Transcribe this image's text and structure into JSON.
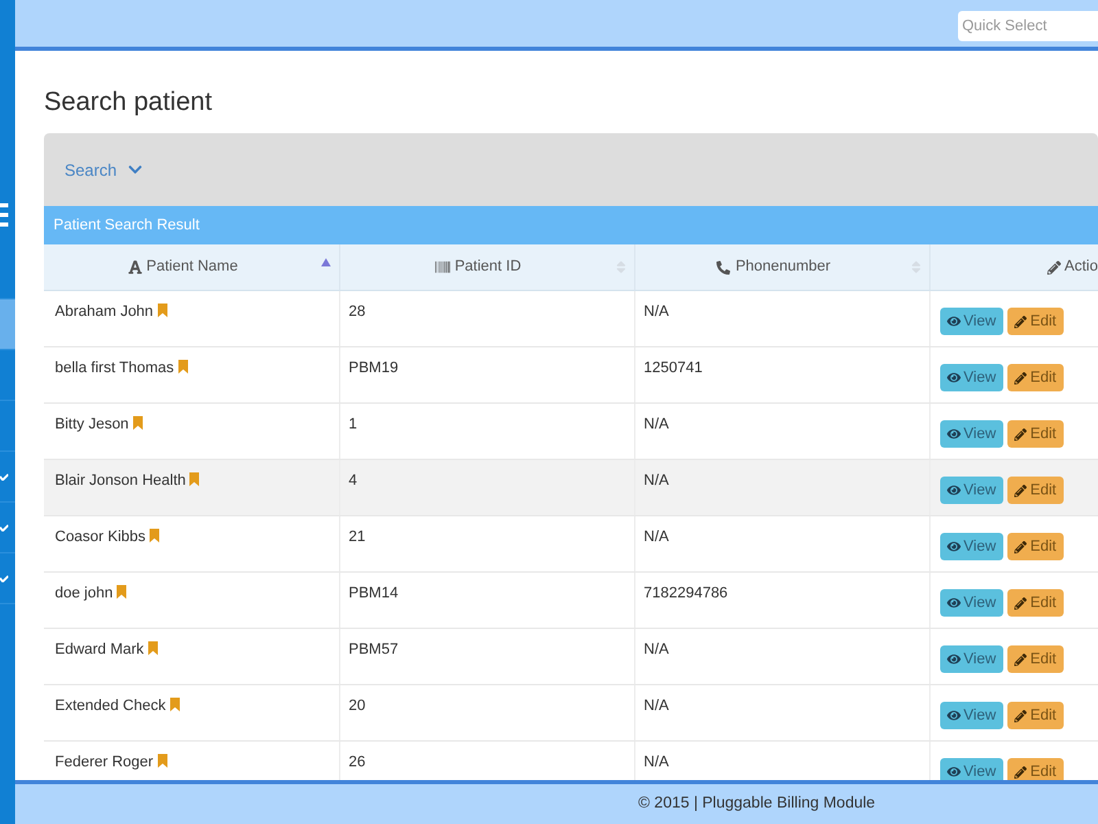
{
  "sidebar": {
    "items": [
      {
        "selected": false,
        "expandable": false
      },
      {
        "selected": true,
        "expandable": false
      },
      {
        "selected": false,
        "expandable": false
      },
      {
        "selected": false,
        "expandable": false
      },
      {
        "selected": false,
        "expandable": true
      },
      {
        "selected": false,
        "expandable": true
      },
      {
        "selected": false,
        "expandable": true
      }
    ]
  },
  "top_bar": {
    "quick_select": {
      "placeholder": "Quick Select"
    }
  },
  "page": {
    "title": "Search patient"
  },
  "search_panel": {
    "label": "Search",
    "expanded": false
  },
  "results": {
    "title": "Patient Search Result",
    "columns": [
      {
        "kind": "name",
        "label": "Patient Name",
        "sorted": true
      },
      {
        "kind": "id",
        "label": "Patient ID",
        "sorted": false
      },
      {
        "kind": "phone",
        "label": "Phonenumber",
        "sorted": false
      },
      {
        "kind": "action",
        "label": "Actio"
      }
    ],
    "rows": [
      {
        "name": "Abraham John",
        "patient_id": "28",
        "phone": "N/A",
        "highlighted": false,
        "actions": [
          {
            "kind": "view",
            "label": "View"
          },
          {
            "kind": "edit",
            "label": "Edit"
          }
        ]
      },
      {
        "name": "bella first Thomas",
        "patient_id": "PBM19",
        "phone": "1250741",
        "highlighted": false,
        "actions": [
          {
            "kind": "view",
            "label": "View"
          },
          {
            "kind": "edit",
            "label": "Edit"
          }
        ]
      },
      {
        "name": "Bitty Jeson",
        "patient_id": "1",
        "phone": "N/A",
        "highlighted": false,
        "actions": [
          {
            "kind": "view",
            "label": "View"
          },
          {
            "kind": "edit",
            "label": "Edit"
          }
        ]
      },
      {
        "name": "Blair Jonson Health",
        "patient_id": "4",
        "phone": "N/A",
        "highlighted": true,
        "actions": [
          {
            "kind": "view",
            "label": "View"
          },
          {
            "kind": "edit",
            "label": "Edit"
          }
        ]
      },
      {
        "name": "Coasor Kibbs",
        "patient_id": "21",
        "phone": "N/A",
        "highlighted": false,
        "actions": [
          {
            "kind": "view",
            "label": "View"
          },
          {
            "kind": "edit",
            "label": "Edit"
          }
        ]
      },
      {
        "name": "doe john",
        "patient_id": "PBM14",
        "phone": "7182294786",
        "highlighted": false,
        "actions": [
          {
            "kind": "view",
            "label": "View"
          },
          {
            "kind": "edit",
            "label": "Edit"
          }
        ]
      },
      {
        "name": "Edward Mark",
        "patient_id": "PBM57",
        "phone": "N/A",
        "highlighted": false,
        "actions": [
          {
            "kind": "view",
            "label": "View"
          },
          {
            "kind": "edit",
            "label": "Edit"
          }
        ]
      },
      {
        "name": "Extended Check",
        "patient_id": "20",
        "phone": "N/A",
        "highlighted": false,
        "actions": [
          {
            "kind": "view",
            "label": "View"
          },
          {
            "kind": "edit",
            "label": "Edit"
          }
        ]
      },
      {
        "name": "Federer Roger",
        "patient_id": "26",
        "phone": "N/A",
        "highlighted": false,
        "actions": [
          {
            "kind": "view",
            "label": "View"
          },
          {
            "kind": "edit",
            "label": "Edit"
          }
        ]
      }
    ]
  },
  "footer": {
    "text": "© 2015 | Pluggable Billing Module"
  }
}
